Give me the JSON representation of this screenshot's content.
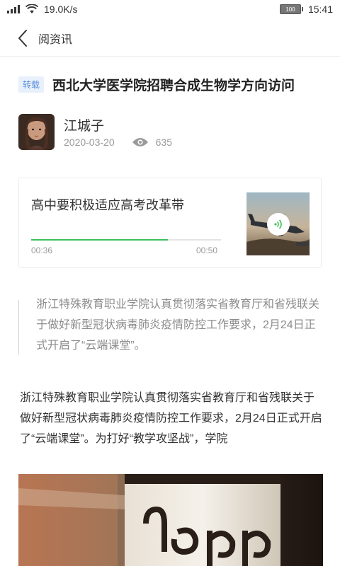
{
  "status_bar": {
    "network_speed": "19.0K/s",
    "battery_level": "100",
    "time": "15:41",
    "signal_icon": "signal-bars-icon",
    "wifi_icon": "wifi-icon"
  },
  "nav": {
    "back_icon": "chevron-left-icon",
    "title": "阅资讯"
  },
  "article": {
    "tag": "转载",
    "title": "西北大学医学院招聘合成生物学方向访问",
    "author_name": "江城子",
    "date": "2020-03-20",
    "view_icon": "eye-icon",
    "view_count": "635"
  },
  "audio": {
    "title": "高中要积极适应高考改革带",
    "current_time": "00:36",
    "total_time": "00:50",
    "progress_fraction": 0.72,
    "play_icon": "sound-wave-icon",
    "accent_color": "#3cbf58"
  },
  "quote": {
    "text": "浙江特殊教育职业学院认真贯彻落实省教育厅和省残联关于做好新型冠状病毒肺炎疫情防控工作要求，2月24日正式开启了“云端课堂”。"
  },
  "body": {
    "text": "浙江特殊教育职业学院认真贯彻落实省教育厅和省残联关于做好新型冠状病毒肺炎疫情防控工作要求，2月24日正式开启了“云端课堂”。为打好“教学攻坚战”，学院"
  },
  "colors": {
    "tag_text": "#5a8fd8",
    "tag_bg": "#e8f0fc"
  }
}
